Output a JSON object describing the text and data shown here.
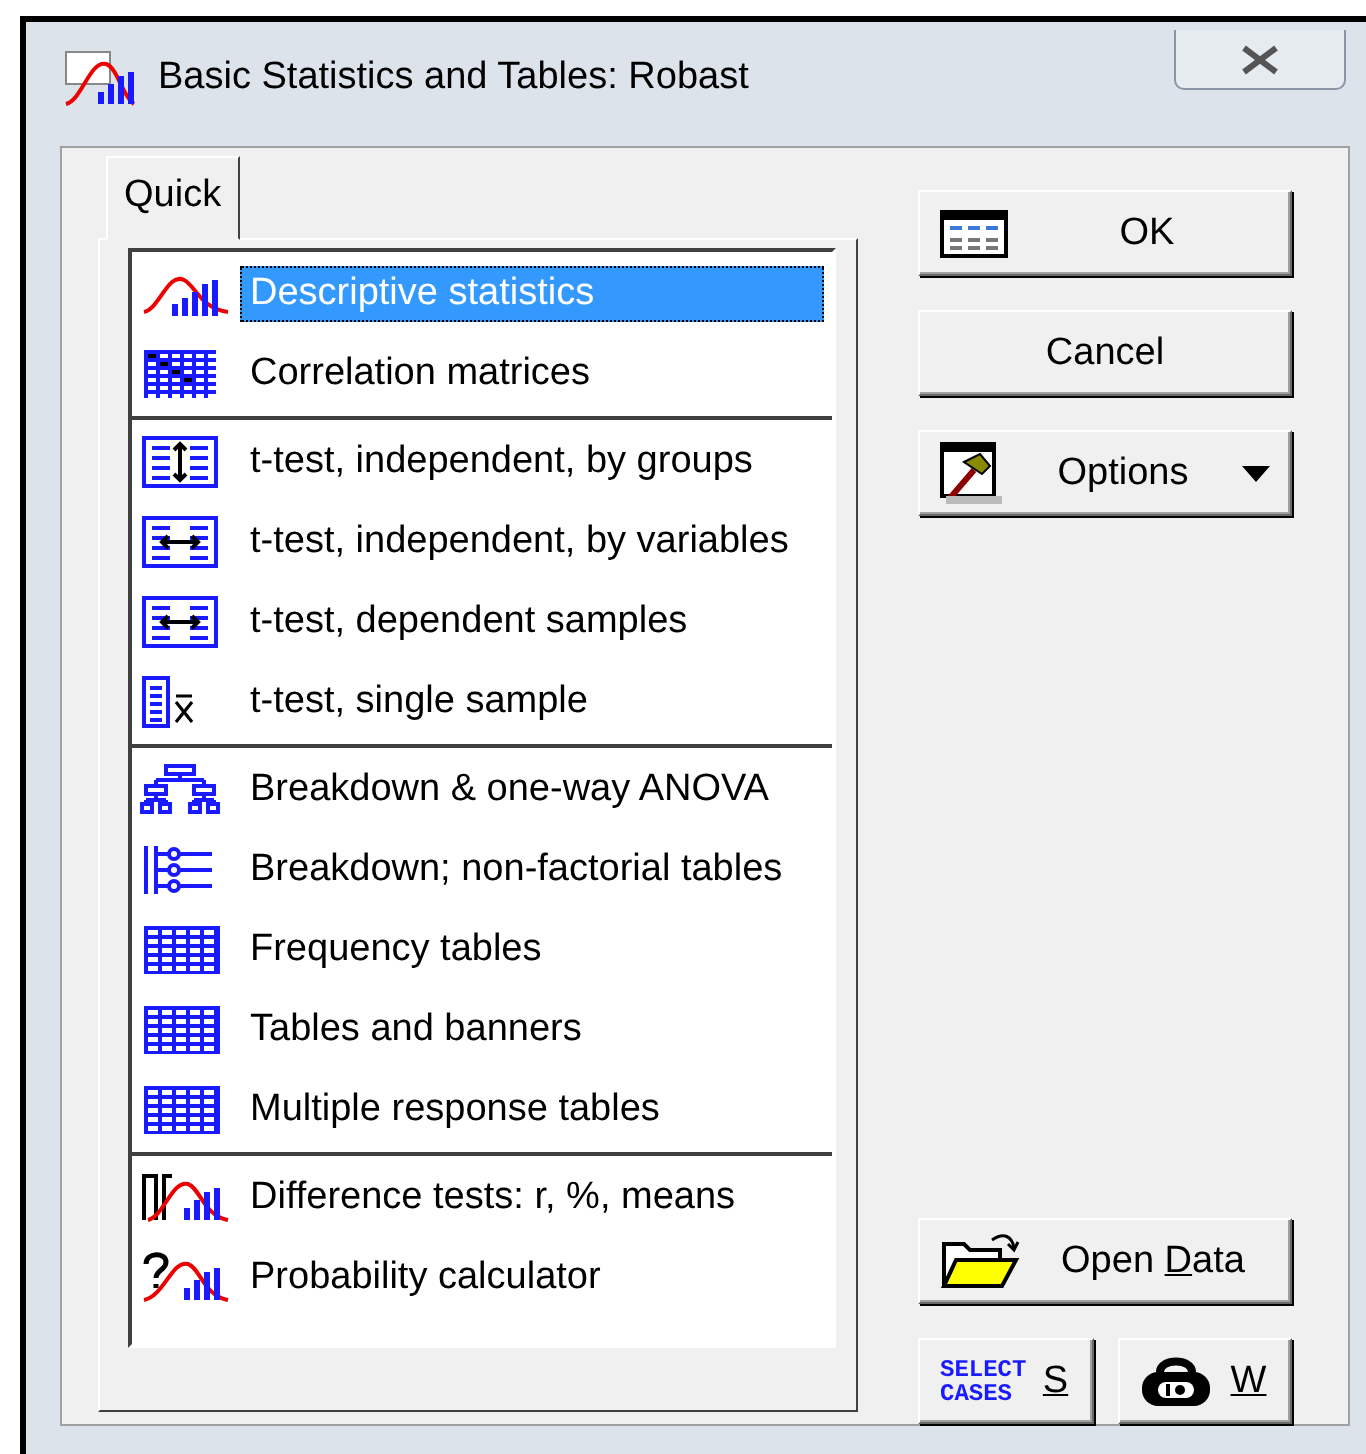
{
  "window": {
    "title": "Basic Statistics and Tables: Robast"
  },
  "tabs": [
    {
      "label": "Quick",
      "selected": true
    }
  ],
  "groups": [
    {
      "items": [
        {
          "label": "Descriptive statistics",
          "selected": true
        },
        {
          "label": "Correlation matrices",
          "selected": false
        }
      ]
    },
    {
      "items": [
        {
          "label": "t-test, independent, by groups",
          "selected": false
        },
        {
          "label": "t-test, independent, by variables",
          "selected": false
        },
        {
          "label": "t-test, dependent samples",
          "selected": false
        },
        {
          "label": "t-test, single sample",
          "selected": false
        }
      ]
    },
    {
      "items": [
        {
          "label": "Breakdown & one-way ANOVA",
          "selected": false
        },
        {
          "label": "Breakdown; non-factorial tables",
          "selected": false
        },
        {
          "label": "Frequency tables",
          "selected": false
        },
        {
          "label": "Tables and banners",
          "selected": false
        },
        {
          "label": "Multiple response tables",
          "selected": false
        }
      ]
    },
    {
      "items": [
        {
          "label": "Difference tests: r, %, means",
          "selected": false
        },
        {
          "label": "Probability calculator",
          "selected": false
        }
      ]
    }
  ],
  "buttons": {
    "ok": "OK",
    "cancel": "Cancel",
    "options": "Options",
    "open_data": {
      "before": "Open ",
      "key": "D",
      "after": "ata"
    },
    "select_cases": {
      "icon_text": "SELECT CASES",
      "key": "S"
    },
    "weight": {
      "key": "W"
    }
  }
}
